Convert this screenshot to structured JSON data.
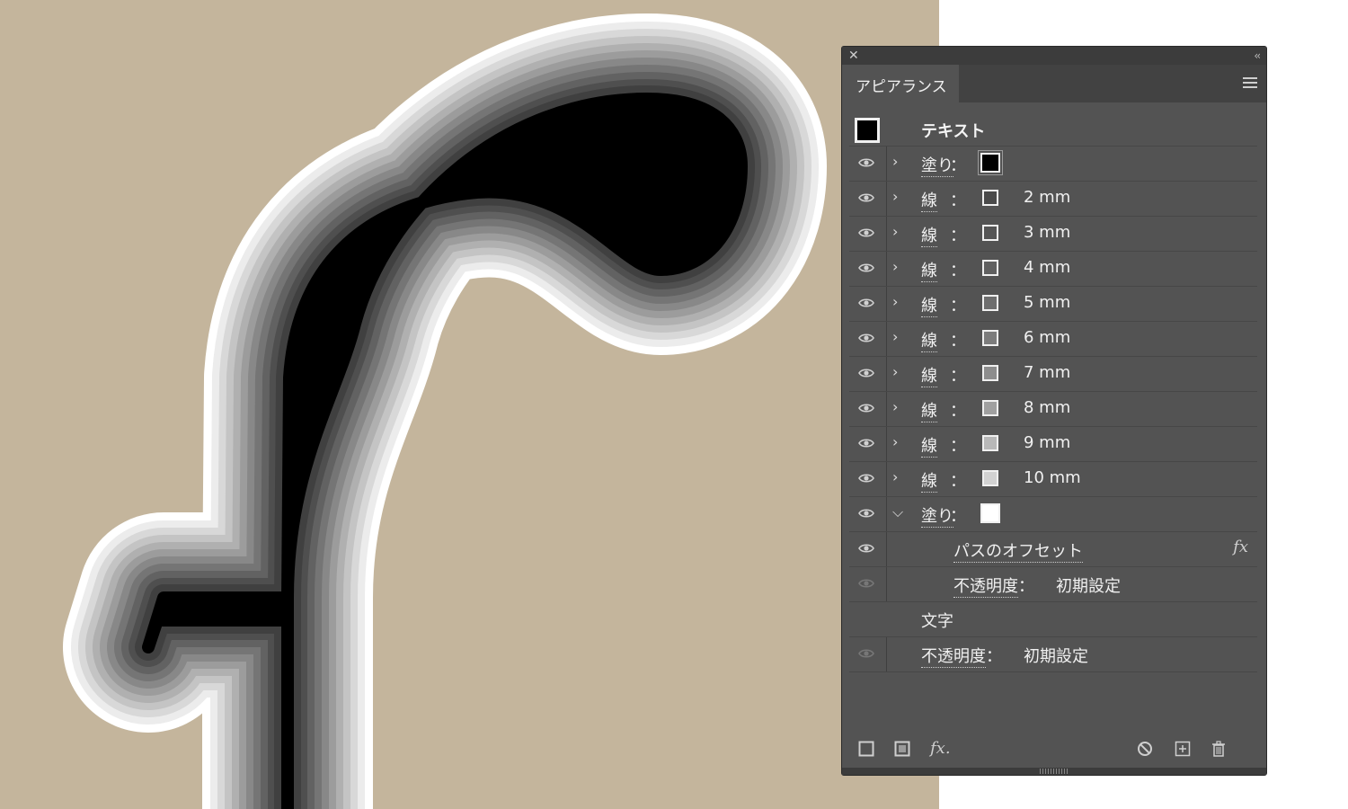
{
  "panel": {
    "tab_label": "アピアランス",
    "header": {
      "title": "テキスト"
    },
    "rows": [
      {
        "label": "塗り",
        "colon": "：",
        "value": "",
        "swatch": "#000000",
        "expanded": false,
        "eye": true
      },
      {
        "label": "線",
        "colon": "：",
        "value": "2 mm",
        "swatch": "#4a4a4a",
        "expanded": false,
        "eye": true
      },
      {
        "label": "線",
        "colon": "：",
        "value": "3 mm",
        "swatch": "#555555",
        "expanded": false,
        "eye": true
      },
      {
        "label": "線",
        "colon": "：",
        "value": "4 mm",
        "swatch": "#606060",
        "expanded": false,
        "eye": true
      },
      {
        "label": "線",
        "colon": "：",
        "value": "5 mm",
        "swatch": "#6e6e6e",
        "expanded": false,
        "eye": true
      },
      {
        "label": "線",
        "colon": "：",
        "value": "6 mm",
        "swatch": "#7c7c7c",
        "expanded": false,
        "eye": true
      },
      {
        "label": "線",
        "colon": "：",
        "value": "7 mm",
        "swatch": "#8d8d8d",
        "expanded": false,
        "eye": true
      },
      {
        "label": "線",
        "colon": "：",
        "value": "8 mm",
        "swatch": "#a0a0a0",
        "expanded": false,
        "eye": true
      },
      {
        "label": "線",
        "colon": "：",
        "value": "9 mm",
        "swatch": "#b8b8b8",
        "expanded": false,
        "eye": true
      },
      {
        "label": "線",
        "colon": "：",
        "value": "10 mm",
        "swatch": "#d2d2d2",
        "expanded": false,
        "eye": true
      },
      {
        "label": "塗り",
        "colon": "：",
        "value": "",
        "swatch": "#ffffff",
        "expanded": true,
        "eye": true
      }
    ],
    "effect": {
      "label": "パスのオフセット",
      "fx": "fx"
    },
    "opacity_inner": {
      "label": "不透明度",
      "colon": "：",
      "value": "初期設定"
    },
    "characters_label": "文字",
    "opacity_outer": {
      "label": "不透明度",
      "colon": "：",
      "value": "初期設定"
    },
    "bottom_fx": "fx."
  },
  "canvas": {
    "letter": "f",
    "background": "#c4b59c"
  }
}
